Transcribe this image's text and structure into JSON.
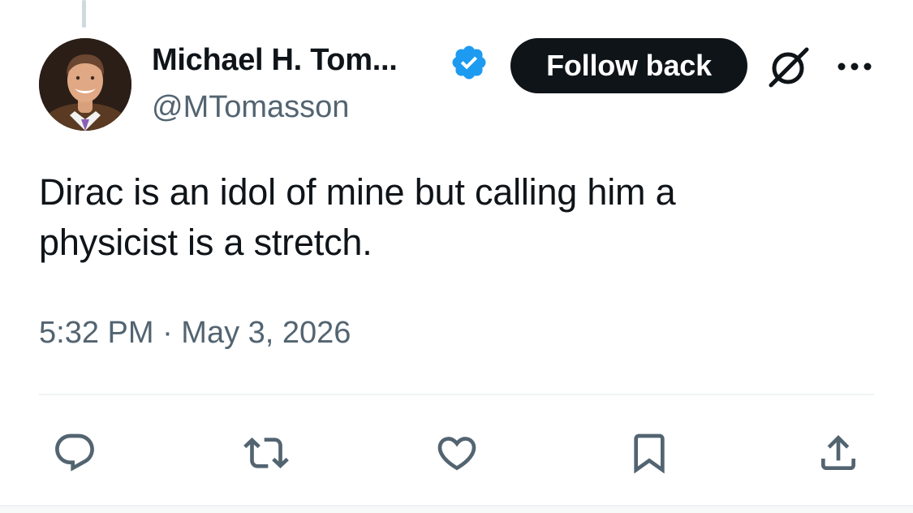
{
  "author": {
    "display_name": "Michael H. Tom...",
    "handle": "@MTomasson",
    "verified": true,
    "avatar": "profile-photo"
  },
  "follow_button": {
    "label": "Follow back"
  },
  "header_icons": [
    "grok-icon",
    "more-icon"
  ],
  "tweet": {
    "text_line1": "Dirac is an idol of mine but calling him a",
    "text_line2": "physicist is a stretch.",
    "timestamp": "5:32 PM · May 3, 2026"
  },
  "actions": [
    {
      "name": "reply",
      "icon": "reply-icon"
    },
    {
      "name": "repost",
      "icon": "repost-icon"
    },
    {
      "name": "like",
      "icon": "heart-icon"
    },
    {
      "name": "bookmark",
      "icon": "bookmark-icon"
    },
    {
      "name": "share",
      "icon": "share-icon"
    }
  ],
  "colors": {
    "text_primary": "#0f1419",
    "text_secondary": "#536471",
    "verified_badge": "#1d9bf0",
    "button_bg": "#0f1419",
    "divider": "#eff3f4"
  }
}
